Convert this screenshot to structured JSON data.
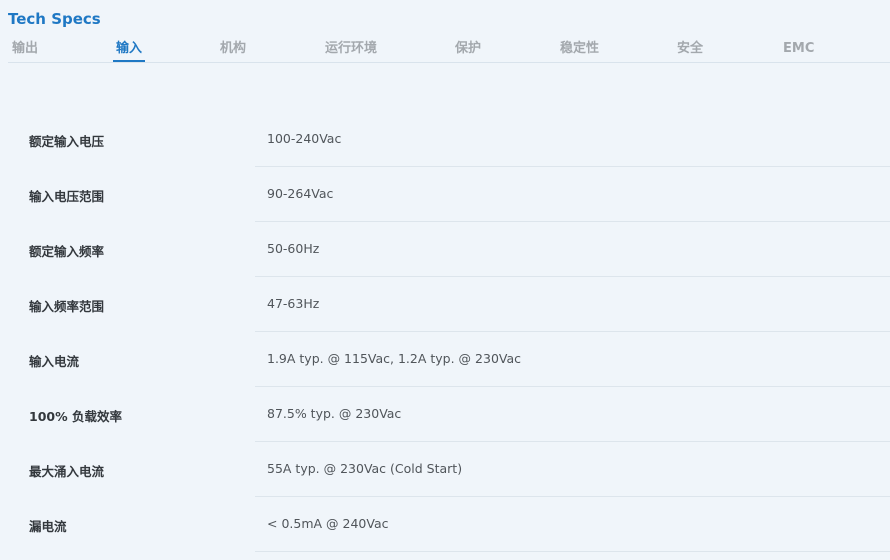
{
  "header": {
    "title": "Tech Specs"
  },
  "tabs": [
    {
      "label": "输出",
      "active": false
    },
    {
      "label": "输入",
      "active": true
    },
    {
      "label": "机构",
      "active": false
    },
    {
      "label": "运行环境",
      "active": false
    },
    {
      "label": "保护",
      "active": false
    },
    {
      "label": "稳定性",
      "active": false
    },
    {
      "label": "安全",
      "active": false
    },
    {
      "label": "EMC",
      "active": false
    }
  ],
  "specs": [
    {
      "label": "额定输入电压",
      "value": "100-240Vac"
    },
    {
      "label": "输入电压范围",
      "value": "90-264Vac"
    },
    {
      "label": "额定输入频率",
      "value": "50-60Hz"
    },
    {
      "label": "输入频率范围",
      "value": "47-63Hz"
    },
    {
      "label": "输入电流",
      "value": "1.9A typ. @ 115Vac, 1.2A typ. @ 230Vac"
    },
    {
      "label": "100% 负载效率",
      "value": "87.5% typ. @ 230Vac"
    },
    {
      "label": "最大涌入电流",
      "value": "55A typ. @ 230Vac (Cold Start)"
    },
    {
      "label": "漏电流",
      "value": "< 0.5mA @ 240Vac"
    }
  ],
  "colors": {
    "accent": "#1f78c4",
    "background": "#f0f5fa",
    "tab_inactive": "#a3a8ad"
  }
}
